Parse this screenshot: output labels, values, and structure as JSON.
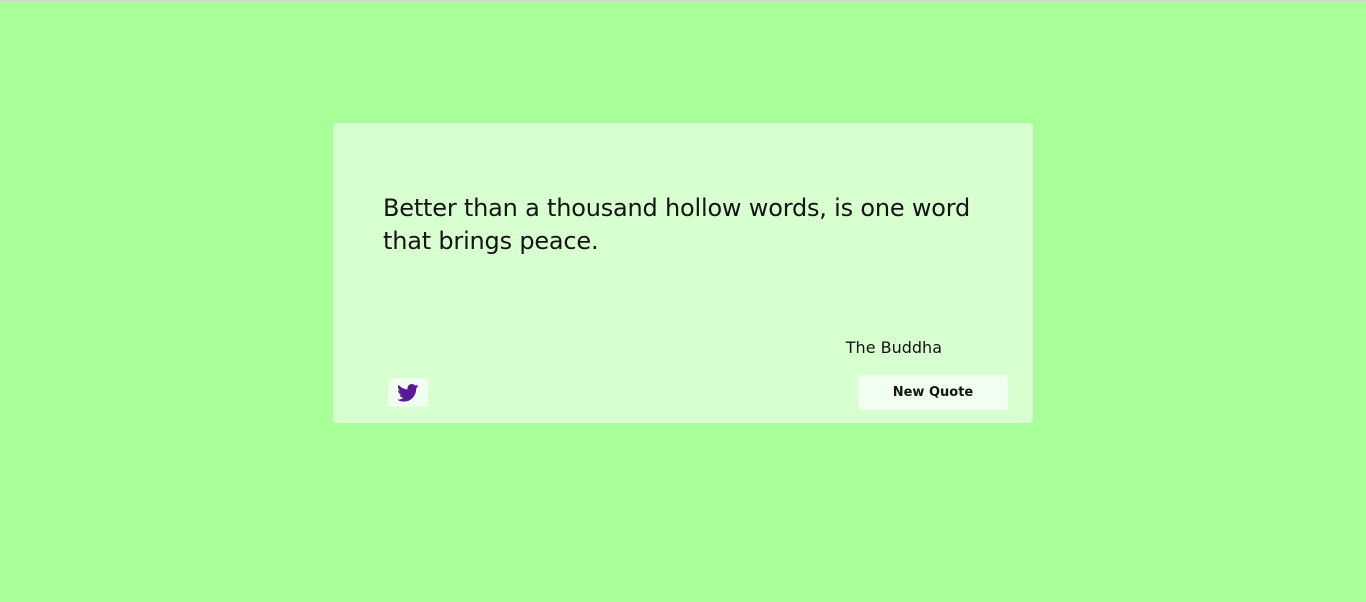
{
  "quote": {
    "text": "Better than a thousand hollow words, is one word that brings peace.",
    "author": "The Buddha"
  },
  "actions": {
    "tweet_icon": "twitter-icon",
    "new_quote_label": "New Quote"
  },
  "colors": {
    "page_background": "#a8ff98",
    "card_background": "#d7ffd0",
    "button_background": "#f1fff0",
    "twitter_icon": "#5b1896",
    "text": "#141414"
  }
}
